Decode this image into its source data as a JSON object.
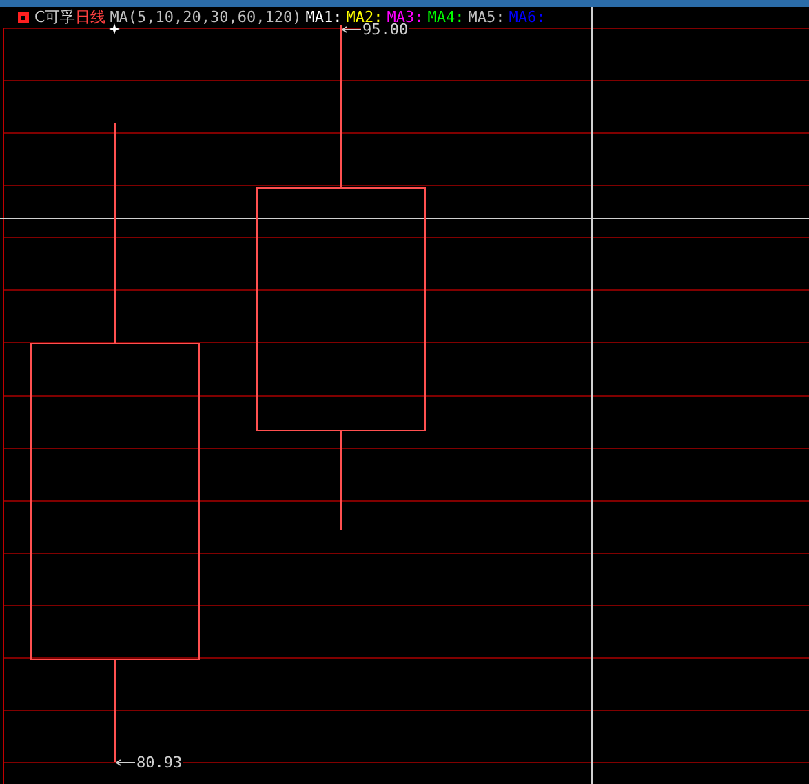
{
  "header": {
    "title": "C可孚",
    "period": "日线",
    "ma_params": "MA(5,10,20,30,60,120)",
    "ma_labels": [
      {
        "label": "MA1:",
        "color": "#ffffff"
      },
      {
        "label": "MA2:",
        "color": "#ffff00"
      },
      {
        "label": "MA3:",
        "color": "#ff00ff"
      },
      {
        "label": "MA4:",
        "color": "#00ff00"
      },
      {
        "label": "MA5:",
        "color": "#c0c0c0"
      },
      {
        "label": "MA6:",
        "color": "#0000ff"
      }
    ]
  },
  "chart": {
    "high_label": "95.00",
    "low_label": "80.93"
  }
}
